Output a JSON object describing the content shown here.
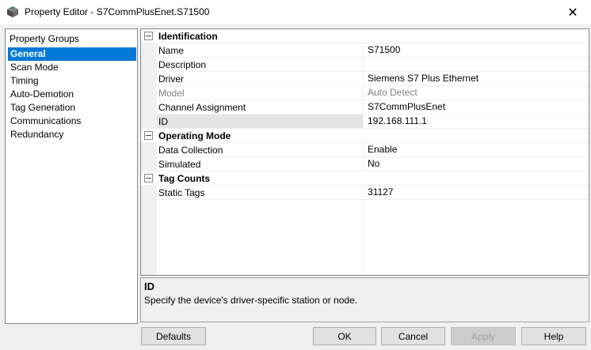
{
  "window": {
    "title": "Property Editor - S7CommPlusEnet.S71500",
    "close_glyph": "✕"
  },
  "groups": {
    "header": "Property Groups",
    "items": [
      "General",
      "Scan Mode",
      "Timing",
      "Auto-Demotion",
      "Tag Generation",
      "Communications",
      "Redundancy"
    ]
  },
  "grid": {
    "identification": {
      "title": "Identification",
      "name": {
        "label": "Name",
        "value": "S71500"
      },
      "description": {
        "label": "Description",
        "value": ""
      },
      "driver": {
        "label": "Driver",
        "value": "Siemens S7 Plus Ethernet"
      },
      "model": {
        "label": "Model",
        "value": "Auto Detect"
      },
      "channel": {
        "label": "Channel Assignment",
        "value": "S7CommPlusEnet"
      },
      "id": {
        "label": "ID",
        "value": "192.168.111.1"
      }
    },
    "operating_mode": {
      "title": "Operating Mode",
      "data_collection": {
        "label": "Data Collection",
        "value": "Enable"
      },
      "simulated": {
        "label": "Simulated",
        "value": "No"
      }
    },
    "tag_counts": {
      "title": "Tag Counts",
      "static_tags": {
        "label": "Static Tags",
        "value": "31127"
      }
    }
  },
  "description_box": {
    "title": "ID",
    "text": "Specify the device's driver-specific station or node."
  },
  "buttons": {
    "defaults": "Defaults",
    "ok": "OK",
    "cancel": "Cancel",
    "apply": "Apply",
    "help": "Help"
  },
  "colors": {
    "selection": "#0078d7",
    "disabled_text": "#808080"
  }
}
